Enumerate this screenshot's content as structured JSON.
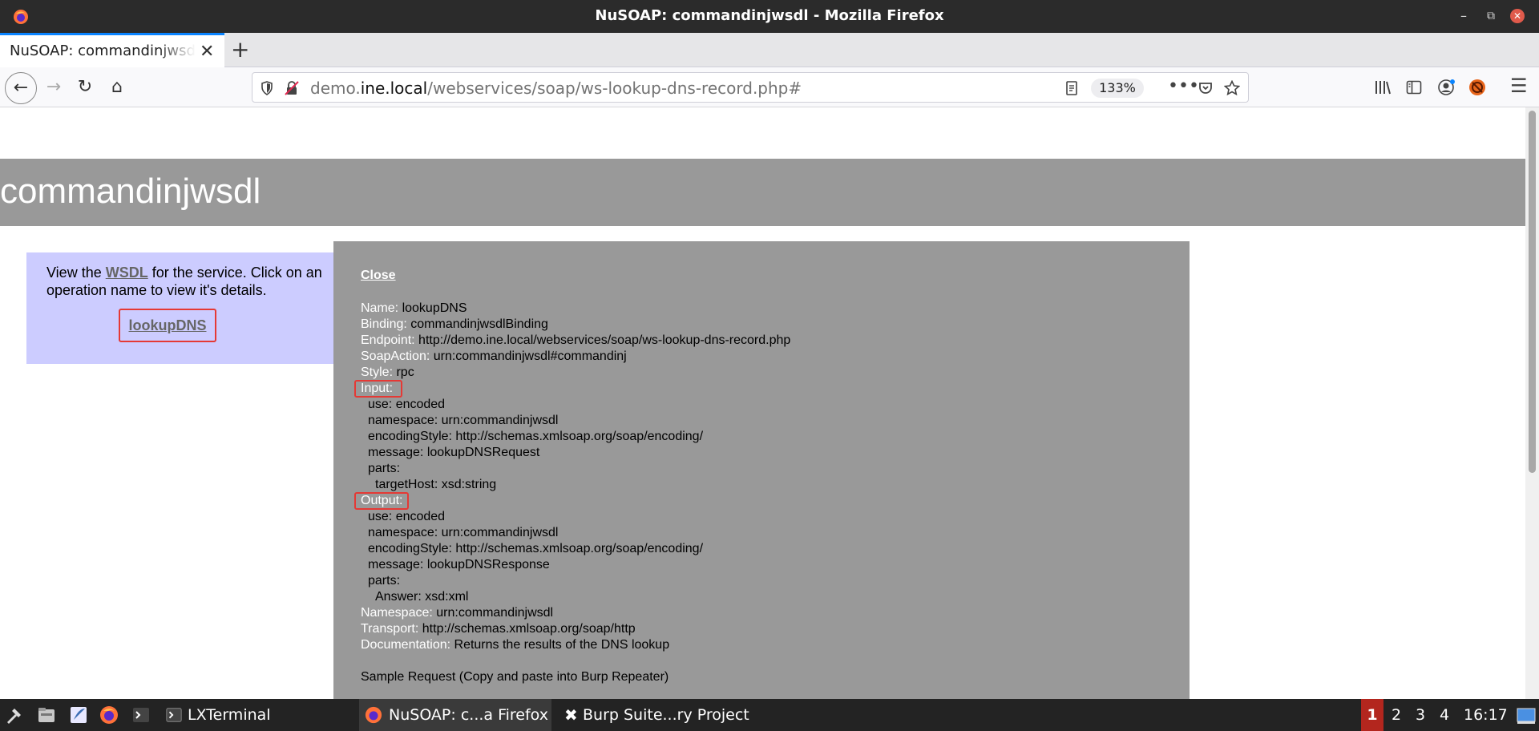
{
  "window": {
    "title": "NuSOAP: commandinjwsdl - Mozilla Firefox",
    "controls": {
      "minimize": "–",
      "restore": "⧉",
      "close": "✕"
    }
  },
  "tabs": [
    {
      "label": "NuSOAP: commandinjwsdl",
      "close": "✕"
    }
  ],
  "new_tab": "+",
  "nav": {
    "back": "←",
    "forward": "→",
    "reload": "↻",
    "home": "⌂",
    "url_prefix": "demo.",
    "url_domain": "ine.local",
    "url_path": "/webservices/soap/ws-lookup-dns-record.php#",
    "zoom": "133%",
    "icons": [
      "shield-icon",
      "insecure-lock-icon",
      "reader-view-icon",
      "more-icon",
      "pocket-icon",
      "bookmark-star-icon",
      "library-icon",
      "sidebar-icon",
      "account-icon",
      "extension-blocked-icon",
      "menu-icon"
    ]
  },
  "page": {
    "heading": "commandinjwsdl",
    "intro_before": "View the ",
    "wsdl_link": "WSDL",
    "intro_after": " for the service. Click on an operation name to view it's details.",
    "operation_link": "lookupDNS"
  },
  "popup": {
    "close_label": "Close",
    "lines": [
      {
        "key": "Name:",
        "value": " lookupDNS",
        "indent": 0
      },
      {
        "key": "Binding:",
        "value": " commandinjwsdlBinding",
        "indent": 0
      },
      {
        "key": "Endpoint:",
        "value": " http://demo.ine.local/webservices/soap/ws-lookup-dns-record.php",
        "indent": 0
      },
      {
        "key": "SoapAction:",
        "value": " urn:commandinjwsdl#commandinj",
        "indent": 0
      },
      {
        "key": "Style:",
        "value": " rpc",
        "indent": 0
      },
      {
        "key": "Input:",
        "value": "",
        "indent": 0,
        "highlight": true
      },
      {
        "key": "",
        "value": "use: encoded",
        "indent": 1
      },
      {
        "key": "",
        "value": "namespace: urn:commandinjwsdl",
        "indent": 1
      },
      {
        "key": "",
        "value": "encodingStyle: http://schemas.xmlsoap.org/soap/encoding/",
        "indent": 1
      },
      {
        "key": "",
        "value": "message: lookupDNSRequest",
        "indent": 1
      },
      {
        "key": "",
        "value": "parts:",
        "indent": 1
      },
      {
        "key": "",
        "value": "targetHost: xsd:string",
        "indent": 2
      },
      {
        "key": "Output:",
        "value": "",
        "indent": 0,
        "highlight": true
      },
      {
        "key": "",
        "value": "use: encoded",
        "indent": 1
      },
      {
        "key": "",
        "value": "namespace: urn:commandinjwsdl",
        "indent": 1
      },
      {
        "key": "",
        "value": "encodingStyle: http://schemas.xmlsoap.org/soap/encoding/",
        "indent": 1
      },
      {
        "key": "",
        "value": "message: lookupDNSResponse",
        "indent": 1
      },
      {
        "key": "",
        "value": "parts:",
        "indent": 1
      },
      {
        "key": "",
        "value": "Answer: xsd:xml",
        "indent": 2
      },
      {
        "key": "Namespace:",
        "value": " urn:commandinjwsdl",
        "indent": 0
      },
      {
        "key": "Transport:",
        "value": " http://schemas.xmlsoap.org/soap/http",
        "indent": 0
      },
      {
        "key": "Documentation:",
        "value": " Returns the results of the DNS lookup",
        "indent": 0
      }
    ],
    "sample_request": "Sample Request (Copy and paste into Burp Repeater)"
  },
  "taskbar": {
    "launchers": [
      "start-menu-icon",
      "file-manager-icon",
      "text-editor-icon",
      "firefox-icon",
      "terminal-icon"
    ],
    "tasks": [
      {
        "label": "LXTerminal",
        "icon": "terminal-icon",
        "active": false
      },
      {
        "label": "NuSOAP: c...a Firefox",
        "icon": "firefox-icon",
        "active": true
      },
      {
        "label": "Burp Suite...ry Project",
        "icon": "burp-icon",
        "active": false
      }
    ],
    "workspaces": [
      "1",
      "2",
      "3",
      "4"
    ],
    "active_workspace": "1",
    "clock": "16:17"
  },
  "colors": {
    "banner": "#999999",
    "left_panel": "#ccccff",
    "popup": "#999999",
    "highlight": "#e53935",
    "taskbar": "#232323",
    "active_workspace": "#b3261e"
  }
}
